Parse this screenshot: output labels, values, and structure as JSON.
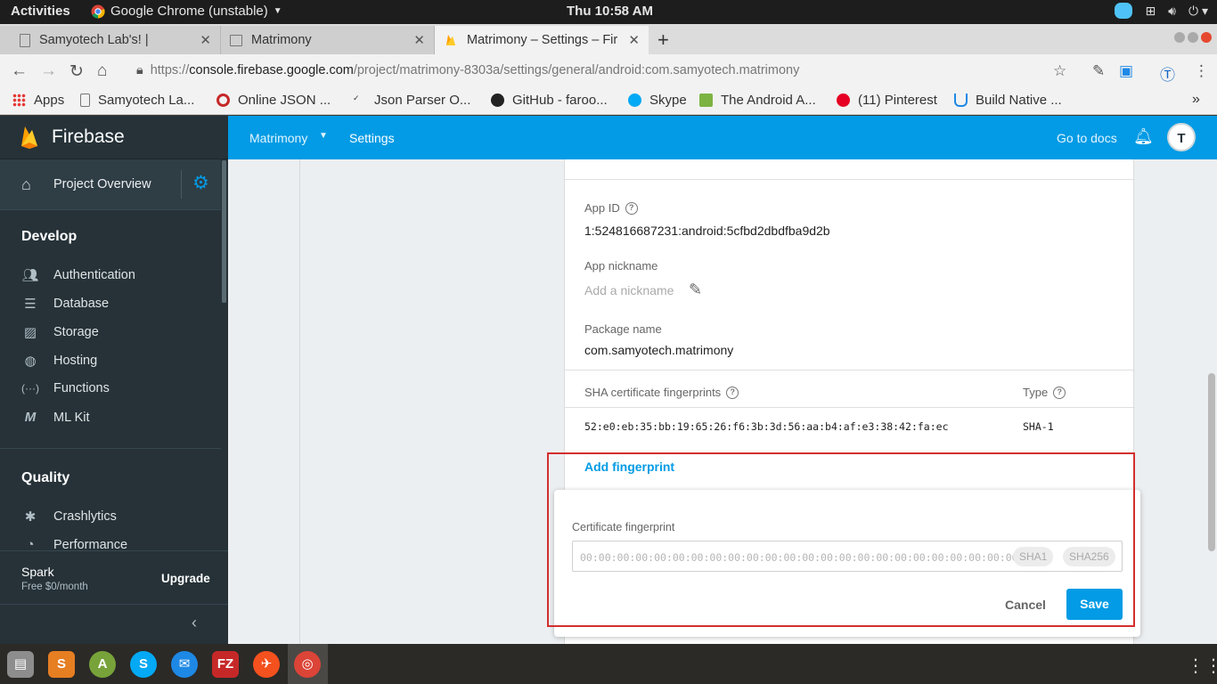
{
  "topbar": {
    "activities": "Activities",
    "app": "Google Chrome (unstable)",
    "clock": "Thu 10:58 AM"
  },
  "tabs": [
    {
      "label": "Samyotech Lab's! |"
    },
    {
      "label": "Matrimony"
    },
    {
      "label": "Matrimony – Settings – Fir"
    }
  ],
  "address": {
    "scheme": "https://",
    "host": "console.firebase.google.com",
    "path": "/project/matrimony-8303a/settings/general/android:com.samyotech.matrimony"
  },
  "bookmarks": [
    {
      "label": "Apps",
      "icon": "apps-grid-icon"
    },
    {
      "label": "Samyotech La...",
      "icon": "page-icon"
    },
    {
      "label": "Online JSON ...",
      "icon": "json-online-icon"
    },
    {
      "label": "Json Parser O...",
      "icon": "json-parser-icon"
    },
    {
      "label": "GitHub - faroo...",
      "icon": "github-icon"
    },
    {
      "label": "Skype",
      "icon": "skype-icon"
    },
    {
      "label": "The Android A...",
      "icon": "android-icon"
    },
    {
      "label": "(11) Pinterest",
      "icon": "pinterest-icon"
    },
    {
      "label": "Build Native ...",
      "icon": "udemy-icon"
    }
  ],
  "sidebar": {
    "brand": "Firebase",
    "project_overview": "Project Overview",
    "sections": {
      "develop": "Develop",
      "quality": "Quality"
    },
    "develop_items": [
      {
        "label": "Authentication",
        "icon": "people-icon"
      },
      {
        "label": "Database",
        "icon": "database-icon"
      },
      {
        "label": "Storage",
        "icon": "image-icon"
      },
      {
        "label": "Hosting",
        "icon": "globe-icon"
      },
      {
        "label": "Functions",
        "icon": "functions-icon"
      },
      {
        "label": "ML Kit",
        "icon": "mlkit-icon"
      }
    ],
    "quality_items": [
      {
        "label": "Crashlytics",
        "icon": "crashlytics-icon"
      },
      {
        "label": "Performance",
        "icon": "performance-icon"
      }
    ],
    "plan": "Spark",
    "price": "Free $0/month",
    "upgrade": "Upgrade"
  },
  "header": {
    "project": "Matrimony",
    "page": "Settings",
    "docs": "Go to docs"
  },
  "app": {
    "app_id_label": "App ID",
    "app_id": "1:524816687231:android:5cfbd2dbdfba9d2b",
    "nickname_label": "App nickname",
    "nickname_placeholder": "Add a nickname",
    "package_label": "Package name",
    "package": "com.samyotech.matrimony",
    "sha_label": "SHA certificate fingerprints",
    "type_label": "Type",
    "fingerprint": "52:e0:eb:35:bb:19:65:26:f6:3b:3d:56:aa:b4:af:e3:38:42:fa:ec",
    "fingerprint_type": "SHA-1",
    "add_fingerprint": "Add fingerprint"
  },
  "fingerprint_form": {
    "label": "Certificate fingerprint",
    "placeholder": "00:00:00:00:00:00:00:00:00:00:00:00:00:00:00:00:00:00:00:00:00:00:00:00",
    "chip_sha1": "SHA1",
    "chip_sha256": "SHA256",
    "cancel": "Cancel",
    "save": "Save"
  },
  "colors": {
    "firebase_blue": "#039be5",
    "sidebar": "#263238",
    "highlight": "#d32f2f"
  }
}
